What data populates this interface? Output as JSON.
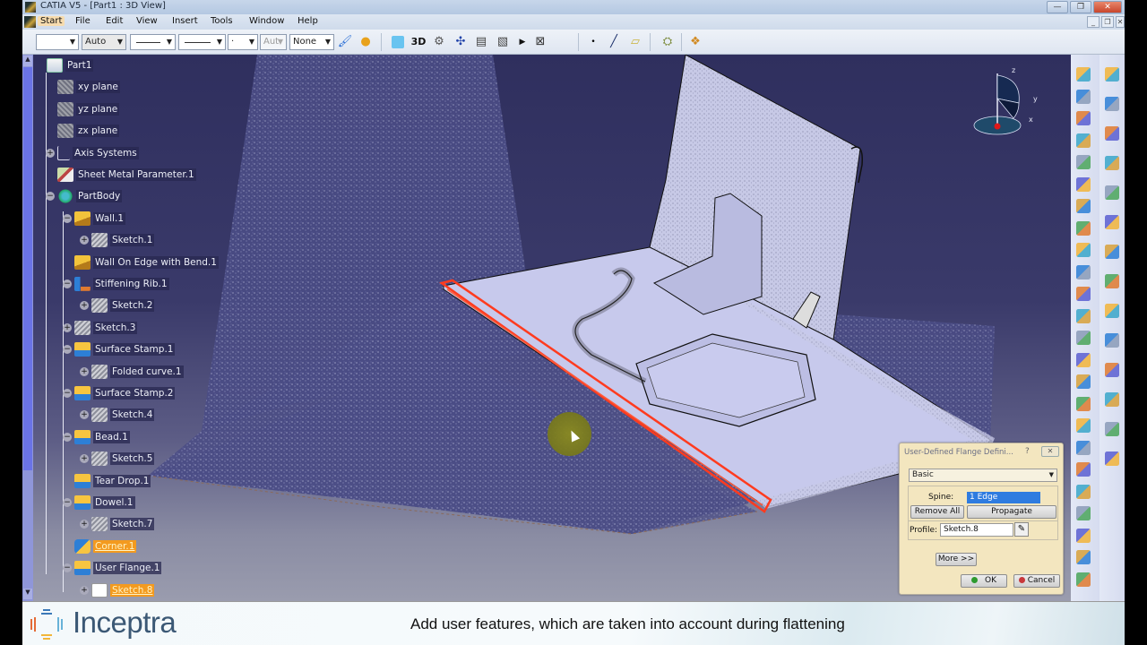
{
  "window": {
    "title": "CATIA V5 - [Part1 : 3D View]",
    "controls": {
      "minimize": "—",
      "restore": "❐",
      "close": "✕"
    },
    "mdi_controls": {
      "minimize": "_",
      "restore": "❐",
      "close": "✕"
    }
  },
  "menu": {
    "items": [
      "Start",
      "File",
      "Edit",
      "View",
      "Insert",
      "Tools",
      "Window",
      "Help"
    ],
    "active": "Start"
  },
  "toolbar": {
    "color_combo": "",
    "layer_combo": "Auto",
    "linetype_combo": "",
    "thickness_combo": "",
    "point_combo": "·",
    "auto_combo": "Aut",
    "none_combo": "None",
    "icons": [
      "painter-brush-icon",
      "painter-sphere-icon",
      "surface-icon",
      "3d-icon",
      "gear-icon",
      "snap-icon",
      "report-icon",
      "report-arrow-icon",
      "play-icon",
      "fast-forward-icon",
      "point-icon",
      "line-icon",
      "plane-icon",
      "analysis-icon",
      "catalog-icon"
    ],
    "3d_label": "3D"
  },
  "tree": {
    "nodes": [
      {
        "label": "Part1",
        "icon": "part",
        "level": 0,
        "expander": ""
      },
      {
        "label": "xy plane",
        "icon": "plane",
        "level": 1,
        "expander": ""
      },
      {
        "label": "yz plane",
        "icon": "plane",
        "level": 1,
        "expander": ""
      },
      {
        "label": "zx plane",
        "icon": "plane",
        "level": 1,
        "expander": ""
      },
      {
        "label": "Axis Systems",
        "icon": "axis",
        "level": 1,
        "expander": "+"
      },
      {
        "label": "Sheet Metal Parameter.1",
        "icon": "smp",
        "level": 1,
        "expander": ""
      },
      {
        "label": "PartBody",
        "icon": "body",
        "level": 1,
        "expander": "−"
      },
      {
        "label": "Wall.1",
        "icon": "wall",
        "level": 2,
        "expander": "−"
      },
      {
        "label": "Sketch.1",
        "icon": "sketch",
        "level": 3,
        "expander": "+"
      },
      {
        "label": "Wall On Edge with Bend.1",
        "icon": "wall",
        "level": 2,
        "expander": ""
      },
      {
        "label": "Stiffening Rib.1",
        "icon": "rib",
        "level": 2,
        "expander": "−"
      },
      {
        "label": "Sketch.2",
        "icon": "sketch",
        "level": 3,
        "expander": "+"
      },
      {
        "label": "Sketch.3",
        "icon": "sketch",
        "level": 2,
        "expander": "+"
      },
      {
        "label": "Surface Stamp.1",
        "icon": "feat",
        "level": 2,
        "expander": "−"
      },
      {
        "label": "Folded curve.1",
        "icon": "sketch",
        "level": 3,
        "expander": "+"
      },
      {
        "label": "Surface Stamp.2",
        "icon": "feat",
        "level": 2,
        "expander": "−"
      },
      {
        "label": "Sketch.4",
        "icon": "sketch",
        "level": 3,
        "expander": "+"
      },
      {
        "label": "Bead.1",
        "icon": "feat",
        "level": 2,
        "expander": "−"
      },
      {
        "label": "Sketch.5",
        "icon": "sketch",
        "level": 3,
        "expander": "+"
      },
      {
        "label": "Tear Drop.1",
        "icon": "feat",
        "level": 2,
        "expander": ""
      },
      {
        "label": "Dowel.1",
        "icon": "feat",
        "level": 2,
        "expander": "−"
      },
      {
        "label": "Sketch.7",
        "icon": "sketch",
        "level": 3,
        "expander": "+"
      },
      {
        "label": "Corner.1",
        "icon": "corner",
        "level": 2,
        "expander": "",
        "highlighted": true
      },
      {
        "label": "User Flange.1",
        "icon": "feat",
        "level": 2,
        "expander": "−"
      },
      {
        "label": "Sketch.8",
        "icon": "sketchsel",
        "level": 3,
        "expander": "+",
        "highlighted": true
      }
    ]
  },
  "compass": {
    "axes": [
      "z",
      "y",
      "x"
    ]
  },
  "right_toolbar_a": {
    "icons": [
      "sketcher-icon",
      "sheet-metal-parameters-icon",
      "bends-from-flat-icon",
      "wall-icon",
      "wall-on-edge-icon",
      "extrusion-icon",
      "swept-walls-icon",
      "stiffening-rib-icon",
      "hole-icon",
      "stamp-icon",
      "user-stamp-icon",
      "corner-relief-icon",
      "chamfer-icon",
      "bend-icon",
      "fold-icon",
      "cutout-icon",
      "pocket-icon",
      "pattern-icon",
      "unfold-icon",
      "recognize-icon",
      "flange-icon",
      "user-flange-icon",
      "hem-icon",
      "tear-drop-icon"
    ]
  },
  "right_toolbar_b": {
    "icons": [
      "fold-unfold-icon",
      "select-icon",
      "multi-view-icon",
      "multi-view-save-icon",
      "bends-icon",
      "grid-icon",
      "assembly-icon",
      "face-icon",
      "save-icon",
      "split-icon",
      "table-icon",
      "annotation-icon",
      "flag-note-icon",
      "process-icon"
    ]
  },
  "dialog": {
    "title": "User-Defined Flange Defini...",
    "help": "?",
    "close": "✕",
    "mode": "Basic",
    "spine_label": "Spine:",
    "spine_value": "1 Edge",
    "remove_all": "Remove All",
    "propagate": "Propagate",
    "profile_label": "Profile:",
    "profile_value": "Sketch.8",
    "more": "More >>",
    "ok": "OK",
    "cancel": "Cancel",
    "ok_color": "#2e9a2e",
    "cancel_color": "#c8383a"
  },
  "caption": {
    "brand": "Inceptra",
    "brand_mark": "®",
    "text": "Add user features, which are taken into account during flattening"
  },
  "colors": {
    "selection": "#ff3b1f",
    "viewport_top": "#2f2f5e",
    "highlight_tree": "#f39a1f"
  }
}
